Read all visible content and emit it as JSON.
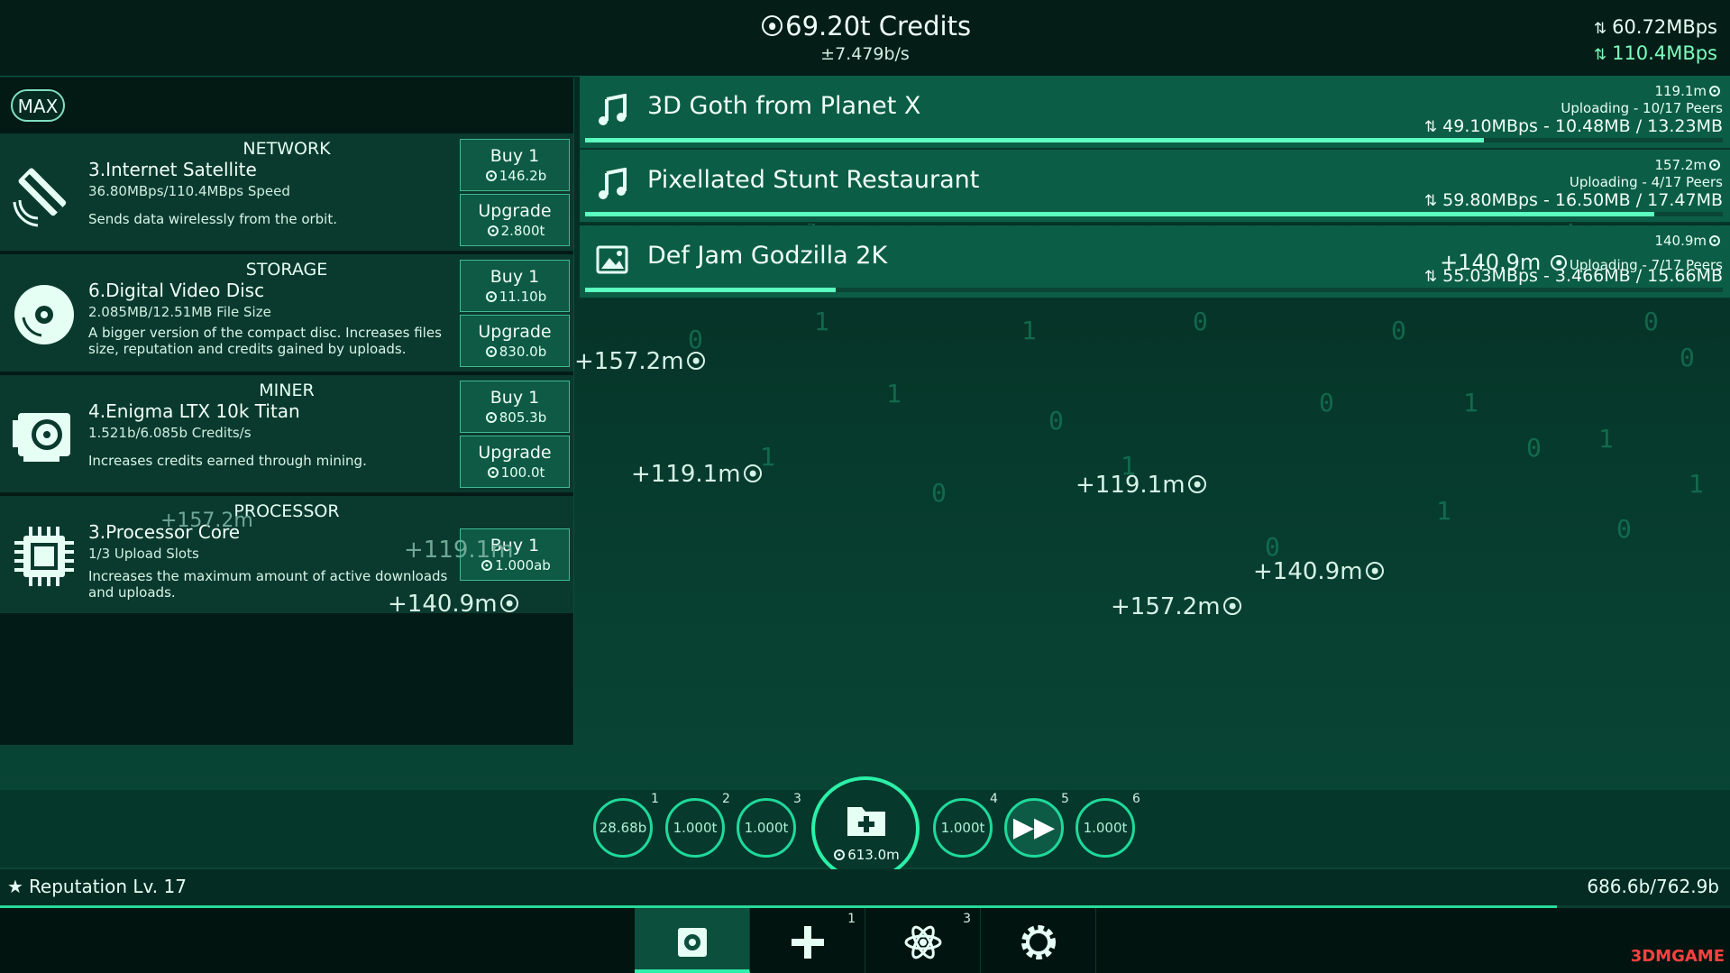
{
  "header": {
    "credits": "69.20t Credits",
    "rate": "±7.479b/s",
    "upload_speed": "60.72MBps",
    "download_speed": "110.4MBps"
  },
  "left_panel": {
    "max_label": "MAX",
    "shops": [
      {
        "category": "NETWORK",
        "name": "3.Internet Satellite",
        "stat": "36.80MBps/110.4MBps Speed",
        "desc": "Sends data wirelessly from the orbit.",
        "buy_label": "Buy 1",
        "buy_price": "146.2b",
        "upgrade_label": "Upgrade",
        "upgrade_price": "2.800t",
        "icon": "satellite-icon"
      },
      {
        "category": "STORAGE",
        "name": "6.Digital Video Disc",
        "stat": "2.085MB/12.51MB File Size",
        "desc": "A bigger version of the compact disc. Increases files size, reputation and credits gained by uploads.",
        "buy_label": "Buy 1",
        "buy_price": "11.10b",
        "upgrade_label": "Upgrade",
        "upgrade_price": "830.0b",
        "icon": "disc-icon"
      },
      {
        "category": "MINER",
        "name": "4.Enigma LTX 10k Titan",
        "stat": "1.521b/6.085b Credits/s",
        "desc": "Increases credits earned through mining.",
        "buy_label": "Buy 1",
        "buy_price": "805.3b",
        "upgrade_label": "Upgrade",
        "upgrade_price": "100.0t",
        "icon": "gpu-icon"
      },
      {
        "category": "PROCESSOR",
        "name": "3.Processor Core",
        "stat": "1/3 Upload Slots",
        "desc": "Increases the maximum amount of active downloads and uploads.",
        "buy_label": "Buy 1",
        "buy_price": "1.000ab",
        "icon": "chip-icon"
      }
    ]
  },
  "downloads": [
    {
      "title": "3D Goth from Planet X",
      "reward": "119.1m",
      "peers": "Uploading - 10/17 Peers",
      "speed": "49.10MBps - 10.48MB / 13.23MB",
      "progress": 0.79,
      "icon": "music-icon"
    },
    {
      "title": "Pixellated Stunt Restaurant",
      "reward": "157.2m",
      "peers": "Uploading - 4/17 Peers",
      "speed": "59.80MBps - 16.50MB / 17.47MB",
      "progress": 0.94,
      "icon": "music-icon"
    },
    {
      "title": "Def Jam Godzilla 2K",
      "reward": "140.9m",
      "peers": "Uploading - 7/17 Peers",
      "speed": "55.03MBps - 3.466MB / 15.66MB",
      "progress": 0.22,
      "icon": "image-icon",
      "popup": "+140.9m"
    }
  ],
  "floats": {
    "f1": "+157.2m",
    "f2": "+119.1m",
    "f3": "+119.1m",
    "f4": "+140.9m",
    "f5": "+157.2m",
    "f6": "+140.9m",
    "f7": "+119.1m",
    "f8": "+157.2m"
  },
  "abilities": [
    {
      "num": "1",
      "price": "28.68b"
    },
    {
      "num": "2",
      "price": "1.000t"
    },
    {
      "num": "3",
      "price": "1.000t"
    },
    {
      "num": "4",
      "price": "1.000t"
    },
    {
      "num": "5",
      "price": ""
    },
    {
      "num": "6",
      "price": "1.000t"
    }
  ],
  "main_action": {
    "price": "613.0m"
  },
  "reputation": {
    "label": "Reputation Lv. 17",
    "value": "686.6b/762.9b",
    "progress": 0.9
  },
  "nav": [
    {
      "badge": ""
    },
    {
      "badge": "1"
    },
    {
      "badge": "3"
    },
    {
      "badge": ""
    }
  ],
  "watermark": "3DMGAME",
  "colors": {
    "accent": "#2df0ad",
    "panel": "#0a3a2d",
    "download_bg": "#0c5d45"
  }
}
